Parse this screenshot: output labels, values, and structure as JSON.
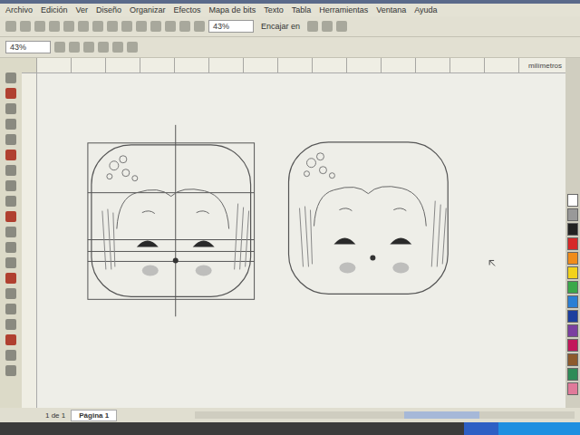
{
  "window": {
    "menu": [
      "Archivo",
      "Edición",
      "Ver",
      "Diseño",
      "Organizar",
      "Efectos",
      "Mapa de bits",
      "Texto",
      "Tabla",
      "Herramientas",
      "Ventana",
      "Ayuda"
    ]
  },
  "toolbar": {
    "zoom": "43%",
    "snap": "Encajar en"
  },
  "property_bar": {
    "zoom": "43%"
  },
  "ruler": {
    "unit": "milímetros"
  },
  "drawings": [
    {
      "guides": true
    },
    {
      "guides": false
    }
  ],
  "palette": [
    {
      "color": "#ffffff"
    },
    {
      "color": "#999999"
    },
    {
      "color": "#222222"
    },
    {
      "color": "#d62828"
    },
    {
      "color": "#f08c1a"
    },
    {
      "color": "#f2d21b"
    },
    {
      "color": "#3aa84a"
    },
    {
      "color": "#2a7fd4"
    },
    {
      "color": "#1c3f9e"
    },
    {
      "color": "#7b3fa0"
    },
    {
      "color": "#c2185b"
    },
    {
      "color": "#8d5a2b"
    },
    {
      "color": "#2e8b57"
    },
    {
      "color": "#e07a9a"
    }
  ],
  "page_bar": {
    "count": "1 de 1",
    "tabs": [
      {
        "label": "Página 1",
        "selected": true
      }
    ]
  }
}
